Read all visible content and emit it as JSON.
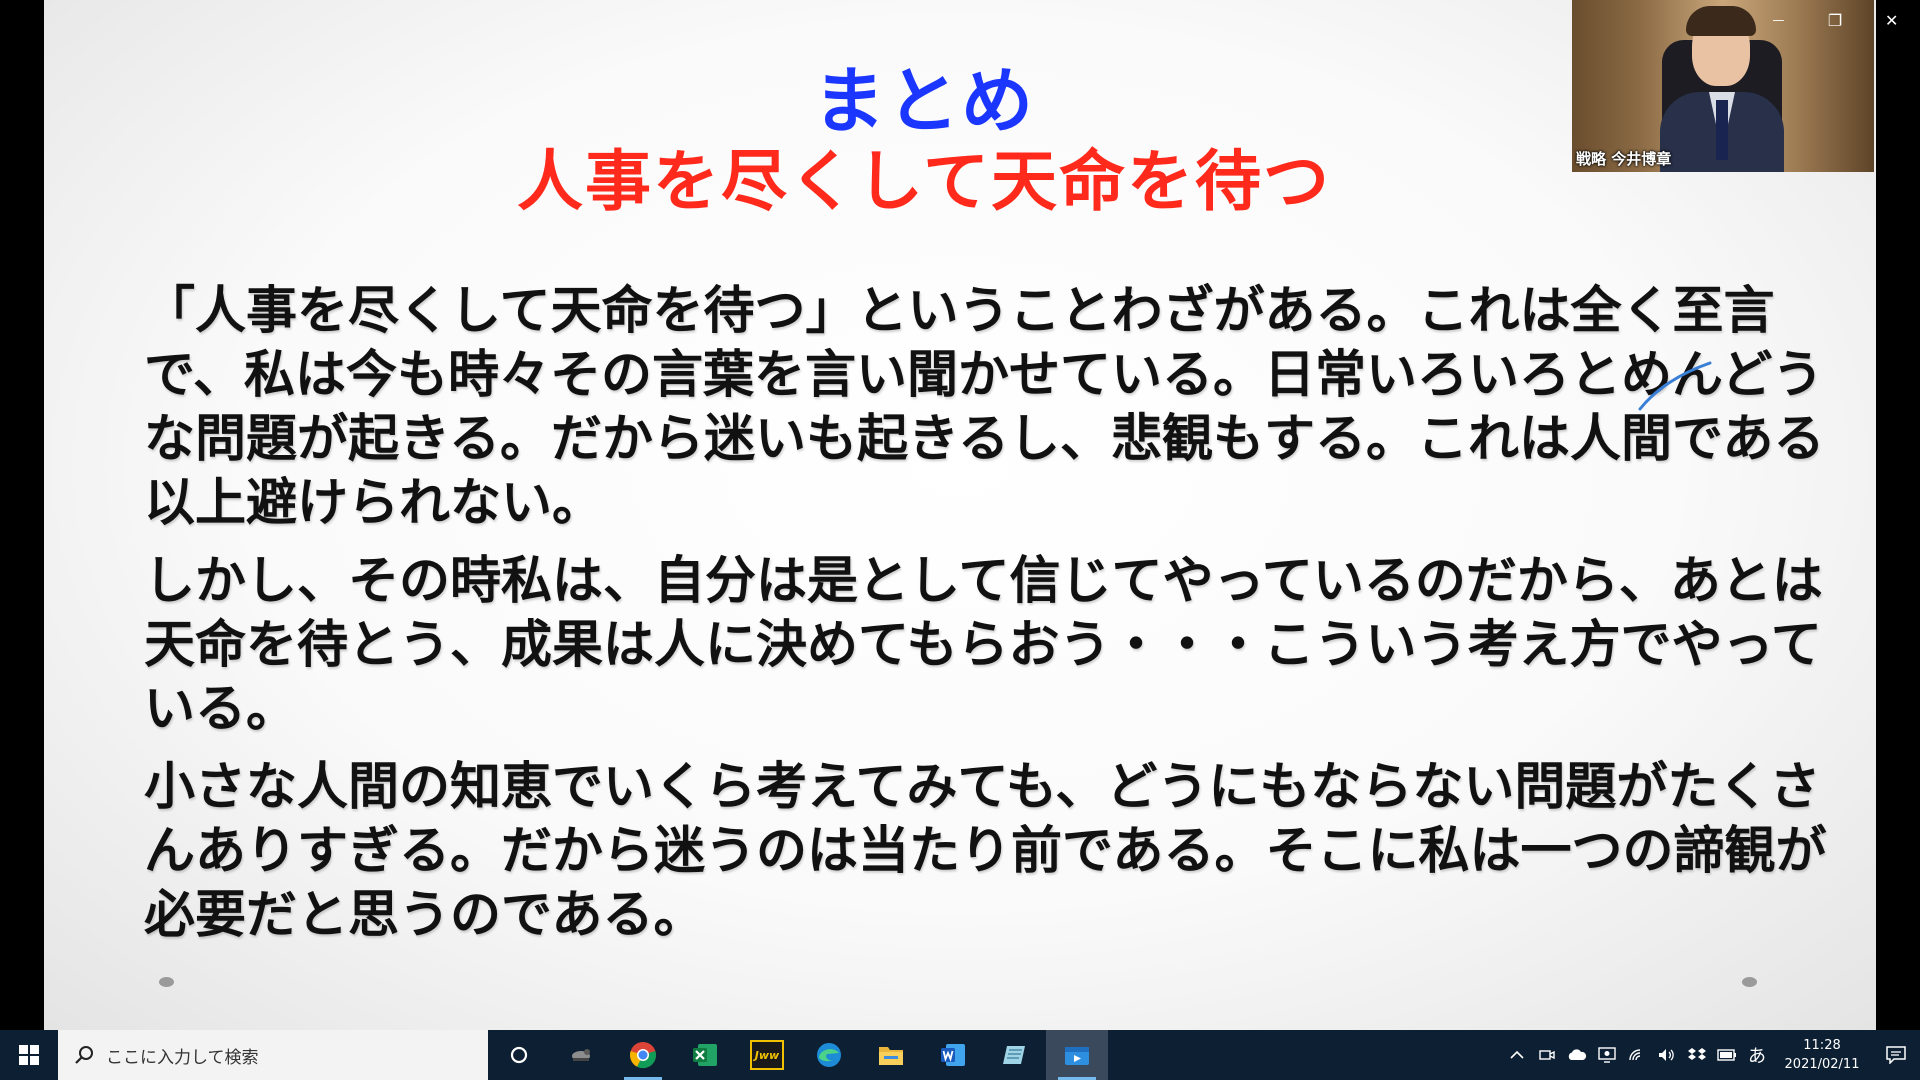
{
  "slide": {
    "title": "まとめ",
    "subtitle": "人事を尽くして天命を待つ",
    "paragraphs": [
      "「人事を尽くして天命を待つ」ということわざがある。これは全く至言で、私は今も時々その言葉を言い聞かせている。日常いろいろとめんどうな問題が起きる。だから迷いも起きるし、悲観もする。これは人間である以上避けられない。",
      "しかし、その時私は、自分は是として信じてやっているのだから、あとは天命を待とう、成果は人に決めてもらおう・・・こういう考え方でやっている。",
      "小さな人間の知恵でいくら考えてみても、どうにもならない問題がたくさんありすぎる。だから迷うのは当たり前である。そこに私は一つの諦観が必要だと思うのである。"
    ],
    "colors": {
      "title": "#1b37ff",
      "subtitle": "#ff2a1c",
      "pen": "#3a7fd6"
    }
  },
  "webcam": {
    "participant_name": "戦略 今井博章"
  },
  "window_controls": {
    "minimize": "—",
    "restore": "❐",
    "close": "✕"
  },
  "taskbar": {
    "search_placeholder": "ここに入力して検索",
    "apps": [
      {
        "icon": "cortana-icon"
      },
      {
        "icon": "task-view-icon"
      },
      {
        "icon": "chrome-icon"
      },
      {
        "icon": "excel-icon"
      },
      {
        "icon": "jww-icon",
        "label": "Jww"
      },
      {
        "icon": "edge-icon"
      },
      {
        "icon": "file-explorer-icon"
      },
      {
        "icon": "word-icon"
      },
      {
        "icon": "notes-app-icon"
      },
      {
        "icon": "presentation-app-icon"
      }
    ],
    "tray": {
      "ime_label": "あ",
      "time": "11:28",
      "date": "2021/02/11"
    }
  }
}
